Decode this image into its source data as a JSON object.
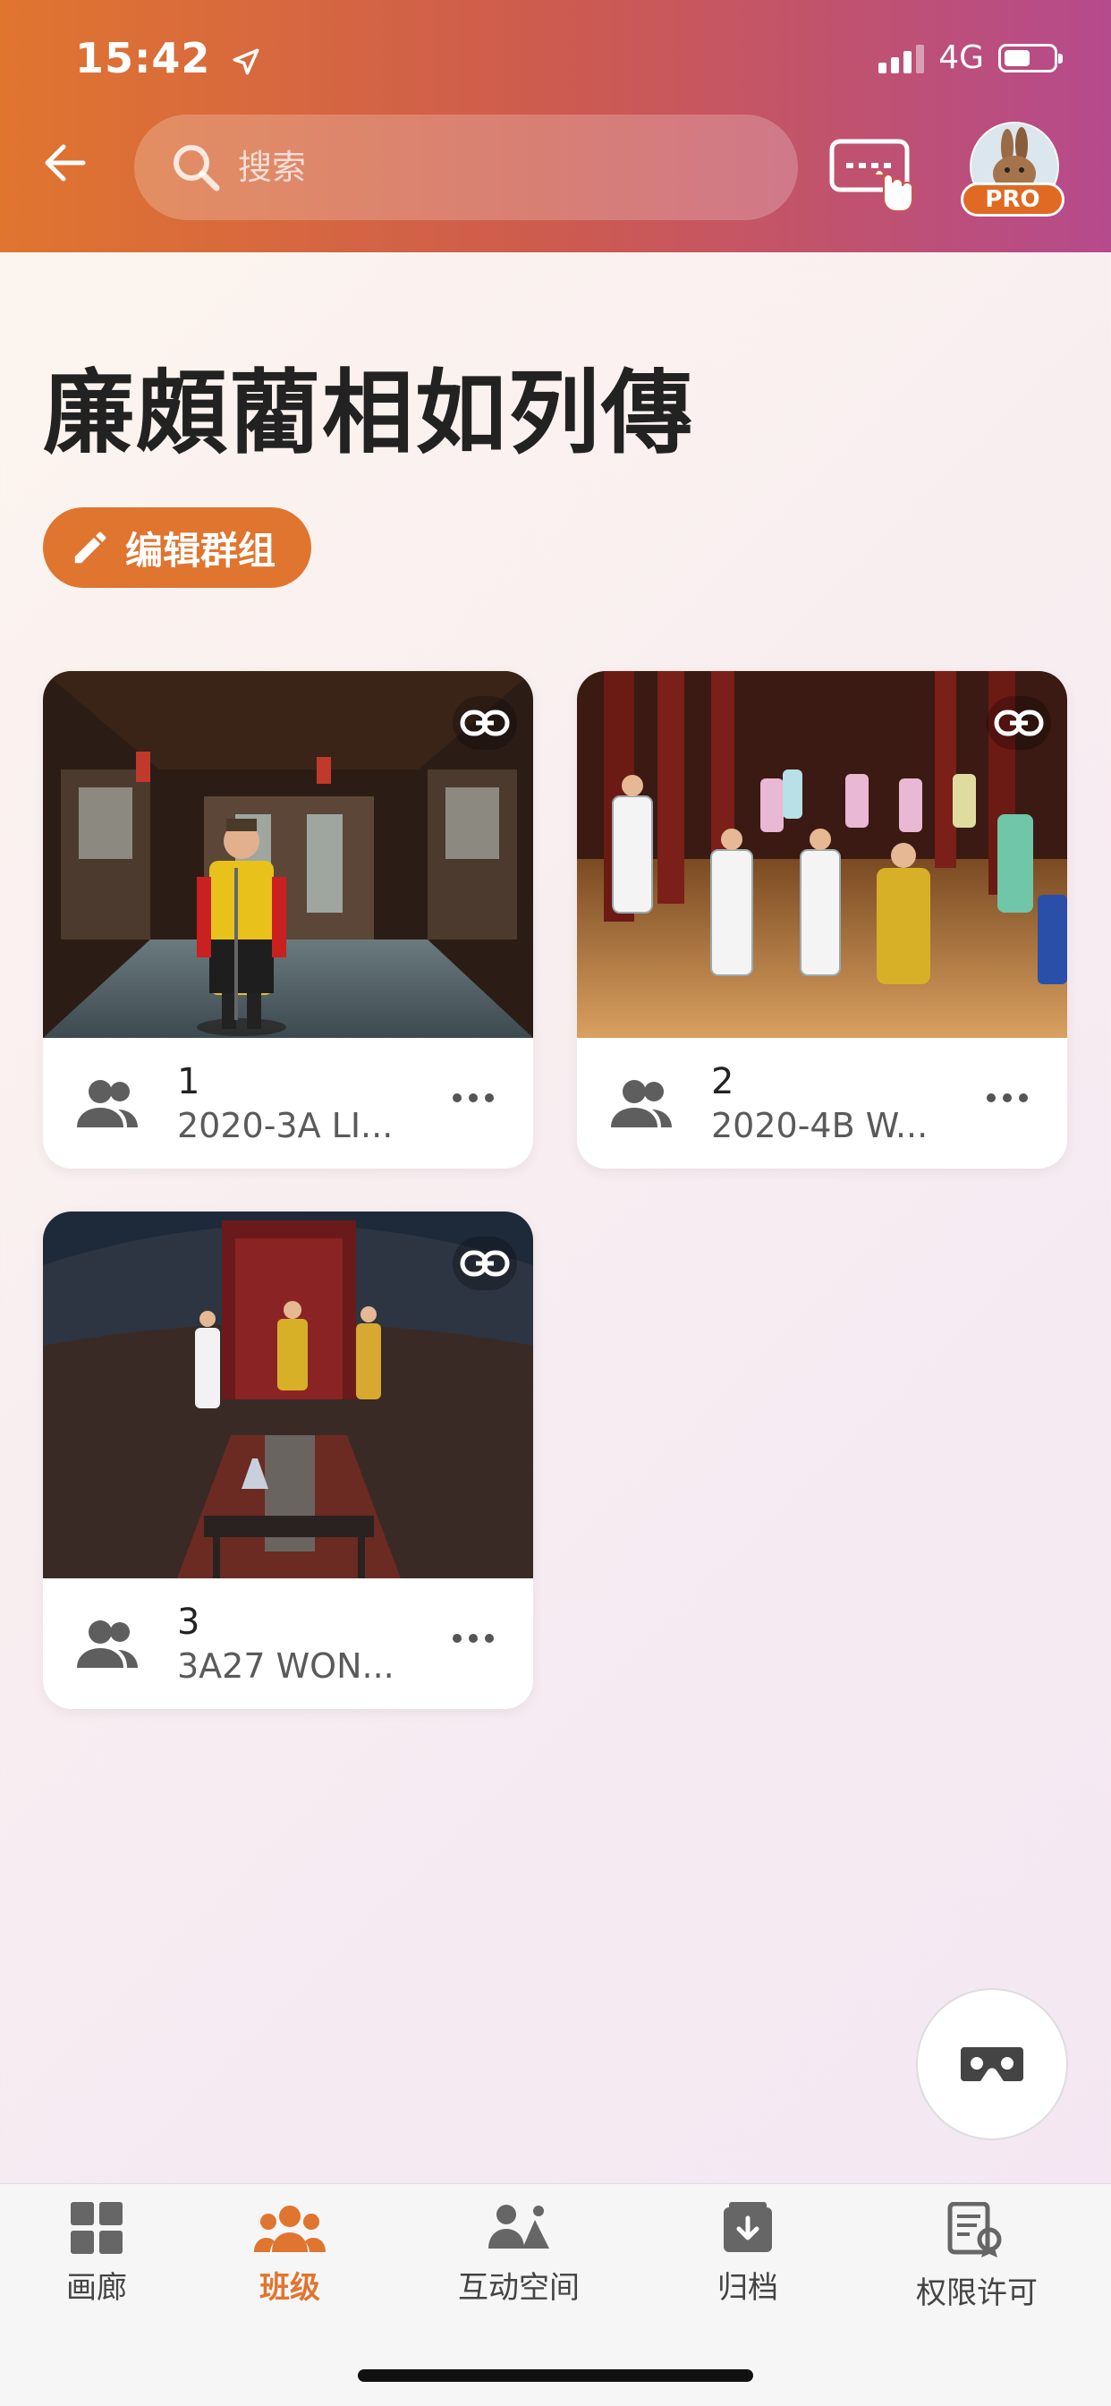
{
  "status_bar": {
    "time": "15:42",
    "network": "4G"
  },
  "header": {
    "search": {
      "placeholder": "搜索"
    },
    "pro_badge": "PRO"
  },
  "page": {
    "title": "廉頗藺相如列傳",
    "edit_button_label": "编辑群组"
  },
  "cards": [
    {
      "number": "1",
      "subtitle": "2020-3A LI..."
    },
    {
      "number": "2",
      "subtitle": "2020-4B W..."
    },
    {
      "number": "3",
      "subtitle": "3A27 WON..."
    }
  ],
  "tabbar": {
    "items": [
      {
        "label": "画廊",
        "icon": "grid-icon"
      },
      {
        "label": "班级",
        "icon": "class-group-icon"
      },
      {
        "label": "互动空间",
        "icon": "interactive-space-icon"
      },
      {
        "label": "归档",
        "icon": "archive-icon"
      },
      {
        "label": "权限许可",
        "icon": "license-icon"
      }
    ],
    "active_index": 1
  },
  "colors": {
    "accent": "#e0752f",
    "header_start": "#e0752f",
    "header_end": "#b54a8c"
  }
}
